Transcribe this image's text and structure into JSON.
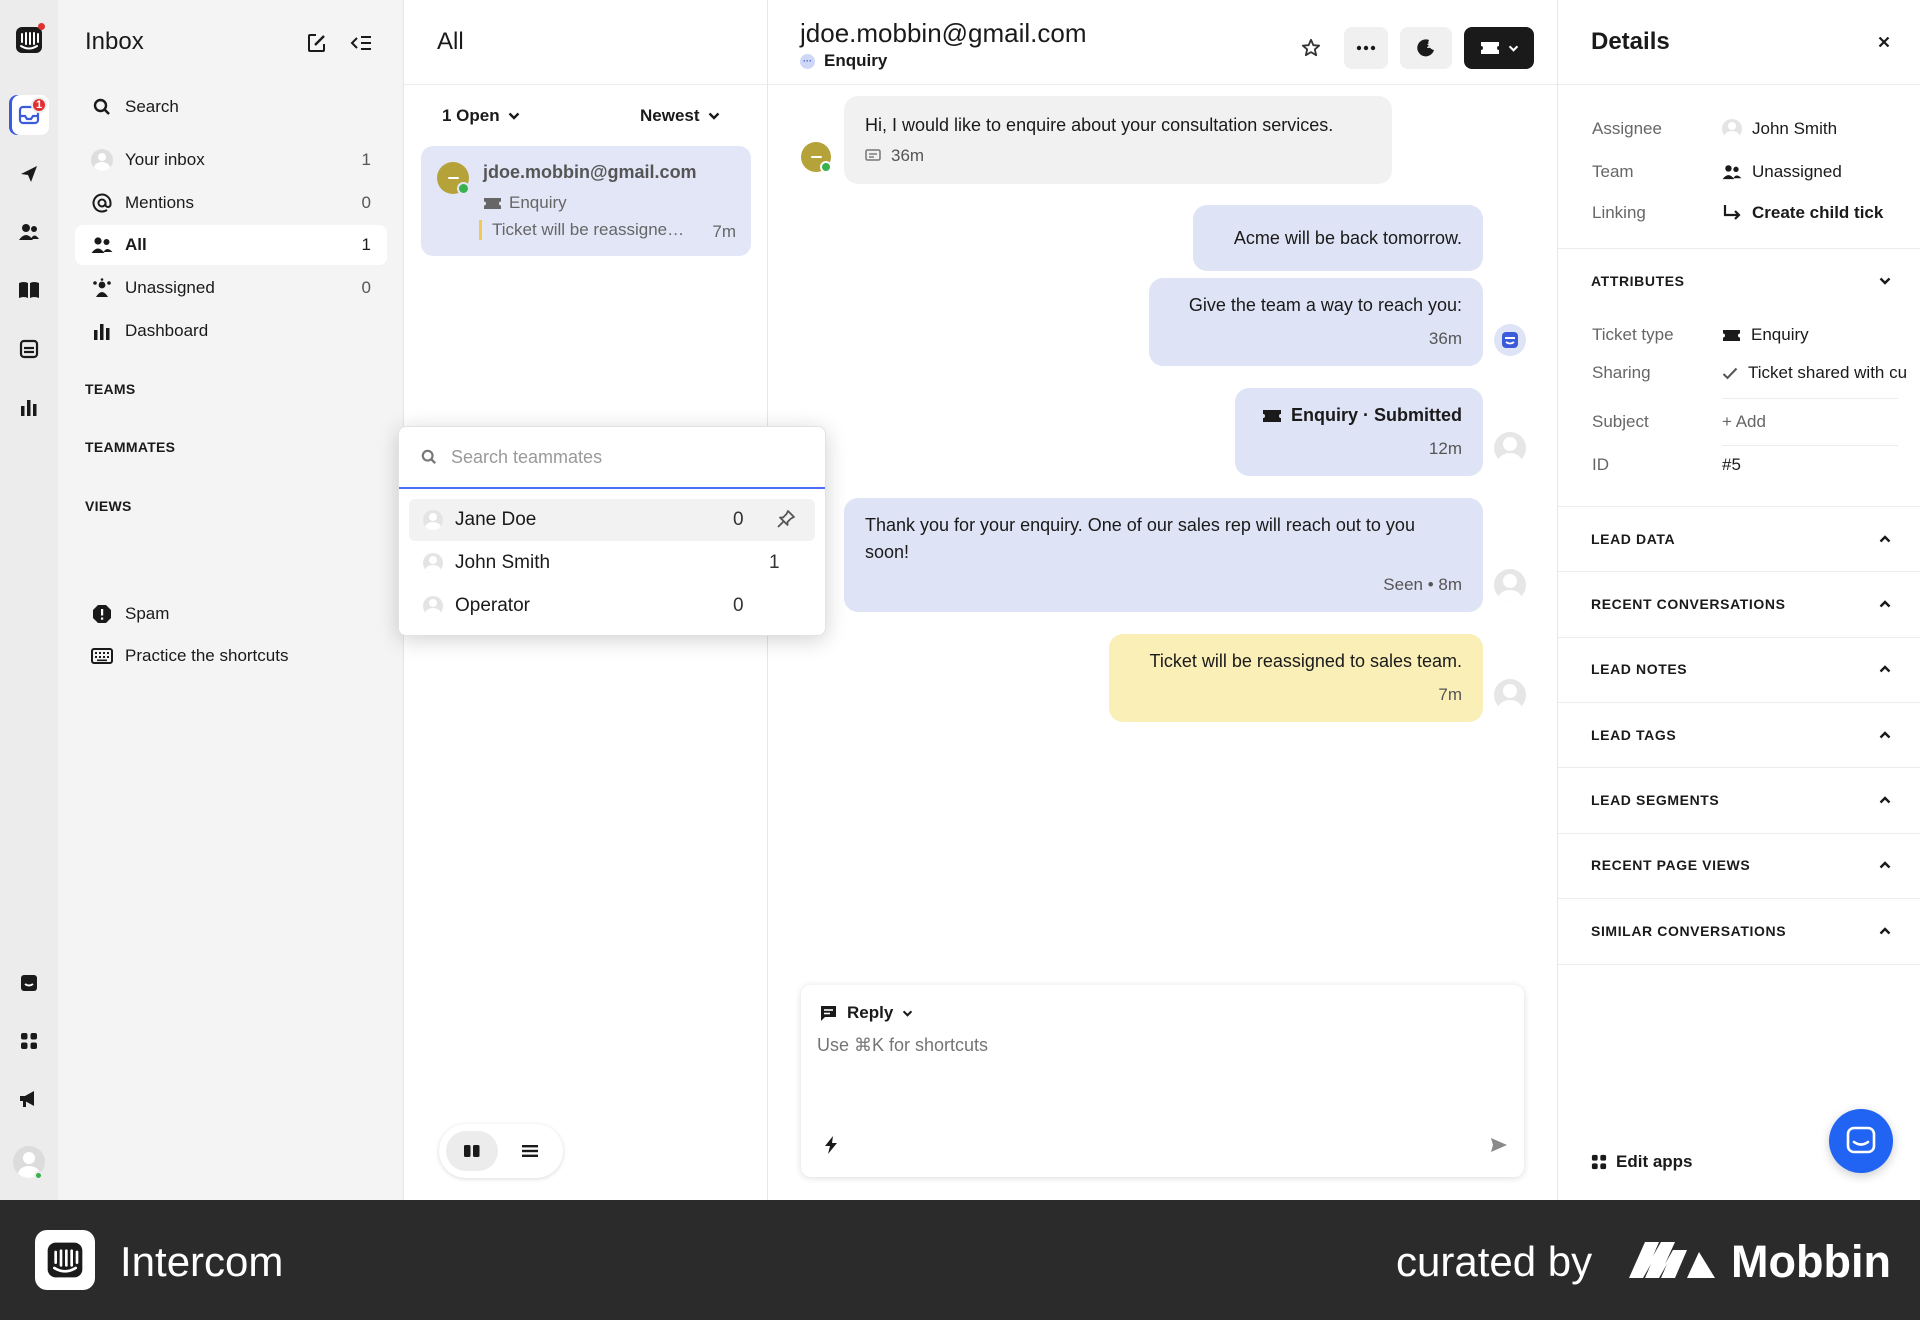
{
  "rail": {
    "inbox_badge": "1"
  },
  "sidebar": {
    "title": "Inbox",
    "items": [
      {
        "label": "Search",
        "count": ""
      },
      {
        "label": "Your inbox",
        "count": "1"
      },
      {
        "label": "Mentions",
        "count": "0"
      },
      {
        "label": "All",
        "count": "1"
      },
      {
        "label": "Unassigned",
        "count": "0"
      },
      {
        "label": "Dashboard",
        "count": ""
      }
    ],
    "sections": [
      "TEAMS",
      "TEAMMATES",
      "VIEWS"
    ],
    "bottom_items": [
      {
        "label": "Spam"
      },
      {
        "label": "Practice the shortcuts"
      }
    ]
  },
  "list": {
    "title": "All",
    "filter_status": "1 Open",
    "filter_sort": "Newest",
    "card": {
      "email": "jdoe.mobbin@gmail.com",
      "type": "Enquiry",
      "preview": "Ticket will be reassigned to sales team.",
      "time": "7m"
    }
  },
  "dropdown": {
    "placeholder": "Search teammates",
    "rows": [
      {
        "name": "Jane Doe",
        "count": "0"
      },
      {
        "name": "John Smith",
        "count": "1"
      },
      {
        "name": "Operator",
        "count": "0"
      }
    ]
  },
  "conversation": {
    "email": "jdoe.mobbin@gmail.com",
    "subtitle": "Enquiry",
    "messages": [
      {
        "text": "Hi, I would like to enquire about your consultation services.",
        "time": "36m"
      },
      {
        "text": "Acme will be back tomorrow."
      },
      {
        "text": "Give the team a way to reach you:",
        "time": "36m"
      },
      {
        "text": "Enquiry · Submitted",
        "time": "12m"
      },
      {
        "text": "Thank you for your enquiry. One of our sales rep will reach out to you soon!",
        "time": "Seen • 8m"
      },
      {
        "text": "Ticket will be reassigned to sales team.",
        "time": "7m"
      }
    ],
    "composer": {
      "mode": "Reply",
      "placeholder": "Use ⌘K for shortcuts"
    }
  },
  "details": {
    "title": "Details",
    "rows": [
      {
        "key": "Assignee",
        "value": "John Smith"
      },
      {
        "key": "Team",
        "value": "Unassigned"
      },
      {
        "key": "Linking",
        "value": "Create child tick"
      }
    ],
    "attributes_label": "ATTRIBUTES",
    "attributes": [
      {
        "key": "Ticket type",
        "value": "Enquiry"
      },
      {
        "key": "Sharing",
        "value": "Ticket shared with cu"
      },
      {
        "key": "Subject",
        "value": "+ Add"
      },
      {
        "key": "ID",
        "value": "#5"
      }
    ],
    "sections": [
      "LEAD DATA",
      "RECENT CONVERSATIONS",
      "LEAD NOTES",
      "LEAD TAGS",
      "LEAD SEGMENTS",
      "RECENT PAGE VIEWS",
      "SIMILAR CONVERSATIONS"
    ],
    "edit_apps": "Edit apps"
  },
  "footer": {
    "brand": "Intercom",
    "curated": "curated by",
    "mobbin": "Mobbin"
  },
  "colors": {
    "accent": "#3b5bdb",
    "outgoing_bubble": "#dfe3f6",
    "note_bubble": "#faefb7",
    "fab": "#2164f3"
  }
}
